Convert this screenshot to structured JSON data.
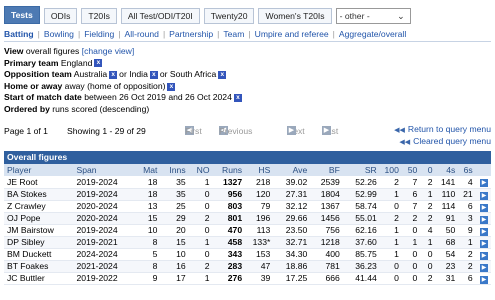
{
  "tabs": [
    {
      "label": "Tests",
      "active": true
    },
    {
      "label": "ODIs",
      "active": false
    },
    {
      "label": "T20Is",
      "active": false
    },
    {
      "label": "All Test/ODI/T20I",
      "active": false
    },
    {
      "label": "Twenty20",
      "active": false
    },
    {
      "label": "Women's T20Is",
      "active": false
    }
  ],
  "other_select": {
    "value": "- other -"
  },
  "subnav": {
    "current": "Batting",
    "items": [
      "Bowling",
      "Fielding",
      "All-round",
      "Partnership",
      "Team",
      "Umpire and referee",
      "Aggregate/overall"
    ]
  },
  "criteria": {
    "view_label": "View",
    "view_value": "overall figures",
    "change_view": "[change view]",
    "primary_label": "Primary team",
    "primary_value": "England",
    "opp_label": "Opposition team",
    "opp_1": "Australia",
    "opp_or1": "or",
    "opp_2": "India",
    "opp_or2": "or",
    "opp_3": "South Africa",
    "home_label": "Home or away",
    "home_value": "away (home of opposition)",
    "start_label": "Start of match date",
    "start_value": "between 26 Oct 2019 and 26 Oct 2024",
    "order_label": "Ordered by",
    "order_value": "runs scored (descending)"
  },
  "pager": {
    "page_text": "Page 1 of 1",
    "showing": "Showing 1 - 29 of 29",
    "first": "First",
    "previous": "Previous",
    "next": "Next",
    "last": "Last"
  },
  "return_link": "Return to query menu",
  "cleared_link": "Cleared query menu",
  "table_title": "Overall figures",
  "columns": [
    "Player",
    "Span",
    "Mat",
    "Inns",
    "NO",
    "Runs",
    "HS",
    "Ave",
    "BF",
    "SR",
    "100",
    "50",
    "0",
    "4s",
    "6s"
  ],
  "rows": [
    [
      "JE Root",
      "2019-2024",
      "18",
      "35",
      "1",
      "1327",
      "218",
      "39.02",
      "2539",
      "52.26",
      "2",
      "7",
      "2",
      "141",
      "4"
    ],
    [
      "BA Stokes",
      "2019-2024",
      "18",
      "35",
      "0",
      "956",
      "120",
      "27.31",
      "1804",
      "52.99",
      "1",
      "6",
      "1",
      "110",
      "21"
    ],
    [
      "Z Crawley",
      "2020-2024",
      "13",
      "25",
      "0",
      "803",
      "79",
      "32.12",
      "1367",
      "58.74",
      "0",
      "7",
      "2",
      "114",
      "6"
    ],
    [
      "OJ Pope",
      "2020-2024",
      "15",
      "29",
      "2",
      "801",
      "196",
      "29.66",
      "1456",
      "55.01",
      "2",
      "2",
      "2",
      "91",
      "3"
    ],
    [
      "JM Bairstow",
      "2019-2024",
      "10",
      "20",
      "0",
      "470",
      "113",
      "23.50",
      "756",
      "62.16",
      "1",
      "0",
      "4",
      "50",
      "9"
    ],
    [
      "DP Sibley",
      "2019-2021",
      "8",
      "15",
      "1",
      "458",
      "133*",
      "32.71",
      "1218",
      "37.60",
      "1",
      "1",
      "1",
      "68",
      "1"
    ],
    [
      "BM Duckett",
      "2024-2024",
      "5",
      "10",
      "0",
      "343",
      "153",
      "34.30",
      "400",
      "85.75",
      "1",
      "0",
      "0",
      "54",
      "2"
    ],
    [
      "BT Foakes",
      "2021-2024",
      "8",
      "16",
      "2",
      "283",
      "47",
      "18.86",
      "781",
      "36.23",
      "0",
      "0",
      "0",
      "23",
      "2"
    ],
    [
      "JC Buttler",
      "2019-2022",
      "9",
      "17",
      "1",
      "276",
      "39",
      "17.25",
      "666",
      "41.44",
      "0",
      "0",
      "2",
      "31",
      "6"
    ]
  ]
}
